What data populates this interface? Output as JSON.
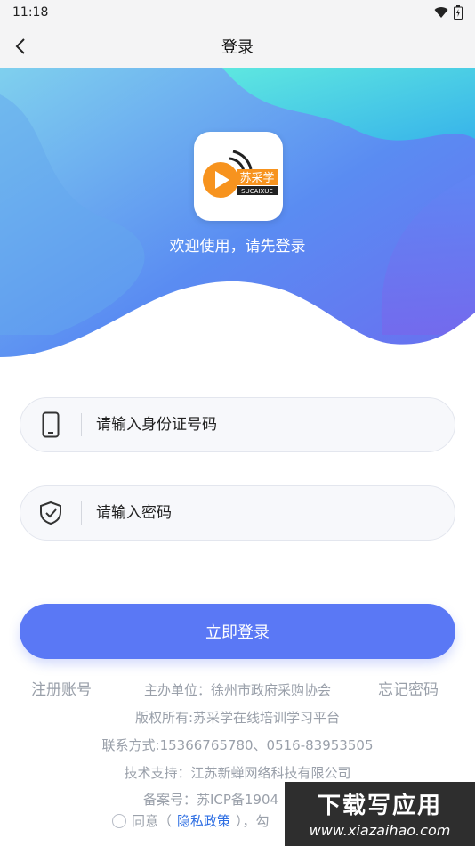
{
  "status_bar": {
    "time": "11:18"
  },
  "nav": {
    "title": "登录"
  },
  "hero": {
    "logo_text_cn": "苏采学",
    "logo_text_en": "SUCAIXUE",
    "welcome": "欢迎使用，请先登录"
  },
  "form": {
    "id_placeholder": "请输入身份证号码",
    "password_placeholder": "请输入密码",
    "login_button": "立即登录"
  },
  "links": {
    "register": "注册账号",
    "forgot_password": "忘记密码"
  },
  "footer": {
    "sponsor": "主办单位：徐州市政府采购协会",
    "copyright": "版权所有:苏采学在线培训学习平台",
    "contact": "联系方式:15366765780、0516-83953505",
    "support": "技术支持：江苏新蝉网络科技有限公司",
    "record": "备案号：苏ICP备1904",
    "agree_prefix": "同意（",
    "policy_link": "隐私政策",
    "agree_suffix": "），勾"
  },
  "watermark": {
    "title": "下载写应用",
    "url": "www.xiazaihao.com"
  },
  "colors": {
    "primary": "#5a78f5",
    "link": "#2f6fe3",
    "muted": "#9aa0aa",
    "hero_blue": "#5a7cf0",
    "hero_teal": "#4fd6e6"
  }
}
